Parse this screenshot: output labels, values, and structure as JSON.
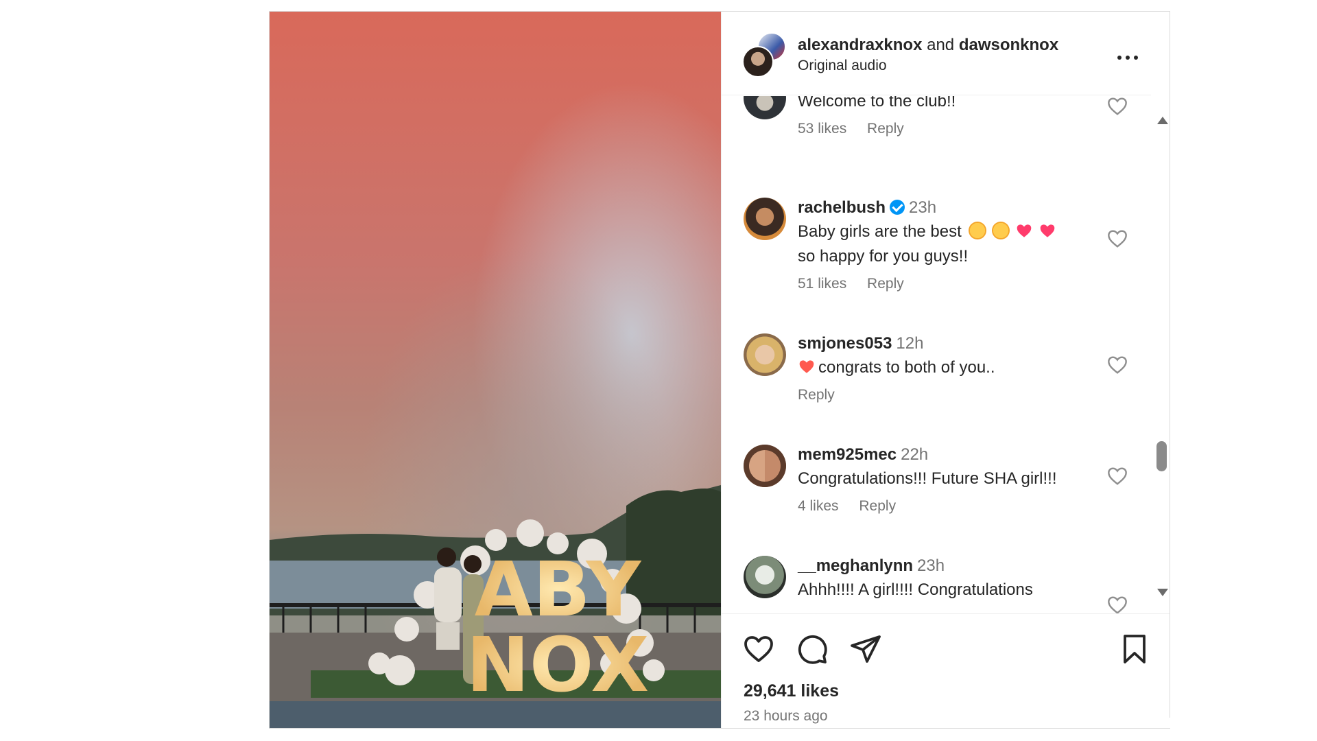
{
  "header": {
    "user1": "alexandraxknox",
    "and_text": "and",
    "user2": "dawsonknox",
    "audio": "Original audio"
  },
  "media": {
    "sign_line1": "ABY",
    "sign_line2": "NOX"
  },
  "comments": [
    {
      "user": "",
      "time": "",
      "text": "Welcome to the club!!",
      "likes": "53 likes",
      "reply": "Reply"
    },
    {
      "user": "rachelbush",
      "verified": true,
      "time": "23h",
      "text_line1": "Baby girls are the best",
      "text_line2": "so happy for you guys!!",
      "likes": "51 likes",
      "reply": "Reply",
      "emojis": [
        "pleading-face",
        "pleading-face",
        "two-hearts",
        "two-hearts"
      ]
    },
    {
      "user": "smjones053",
      "time": "12h",
      "text": "congrats to both of you..",
      "reply": "Reply",
      "emojis": [
        "heart-on-fire"
      ]
    },
    {
      "user": "mem925mec",
      "time": "22h",
      "text": "Congratulations!!! Future SHA girl!!!",
      "likes": "4 likes",
      "reply": "Reply"
    },
    {
      "user": "__meghanlynn",
      "time": "23h",
      "text": "Ahhh!!!! A girl!!!! Congratulations"
    }
  ],
  "footer": {
    "likes": "29,641 likes",
    "time_ago": "23 hours ago"
  },
  "colors": {
    "text": "#262626",
    "secondary": "#737373",
    "verified": "#0095f6",
    "heart_emoji": "#ff3b6b"
  }
}
